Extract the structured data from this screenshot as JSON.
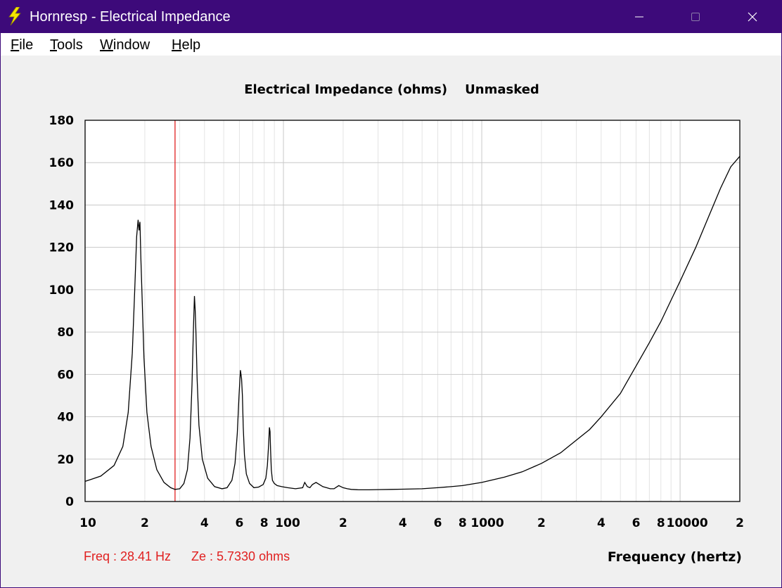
{
  "window": {
    "title": "Hornresp - Electrical Impedance",
    "accent": "#3d0a7a",
    "controls": [
      "minimize-icon",
      "maximize-icon",
      "close-icon"
    ]
  },
  "menu": [
    {
      "label": "File",
      "underline": "F"
    },
    {
      "label": "Tools",
      "underline": "T"
    },
    {
      "label": "Window",
      "underline": "W"
    },
    {
      "label": "Help",
      "underline": "H"
    }
  ],
  "status": {
    "freq": "Freq : 28.41 Hz",
    "ze": "Ze : 5.7330 ohms",
    "color": "#e02020"
  },
  "chart_data": {
    "type": "line",
    "title": "Electrical Impedance (ohms)    Unmasked",
    "xlabel": "Frequency (hertz)",
    "ylabel": "",
    "x_scale": "log",
    "xlim": [
      10,
      20000
    ],
    "ylim": [
      0,
      180
    ],
    "y_ticks": [
      "0",
      "20",
      "40",
      "60",
      "80",
      "100",
      "120",
      "140",
      "160",
      "180"
    ],
    "x_tick_labels": [
      {
        "value": 10,
        "label": "10"
      },
      {
        "value": 20,
        "label": "2"
      },
      {
        "value": 40,
        "label": "4"
      },
      {
        "value": 60,
        "label": "6"
      },
      {
        "value": 80,
        "label": "8"
      },
      {
        "value": 100,
        "label": "100"
      },
      {
        "value": 200,
        "label": "2"
      },
      {
        "value": 400,
        "label": "4"
      },
      {
        "value": 600,
        "label": "6"
      },
      {
        "value": 800,
        "label": "8"
      },
      {
        "value": 1000,
        "label": "1000"
      },
      {
        "value": 2000,
        "label": "2"
      },
      {
        "value": 4000,
        "label": "4"
      },
      {
        "value": 6000,
        "label": "6"
      },
      {
        "value": 8000,
        "label": "8"
      },
      {
        "value": 10000,
        "label": "10000"
      },
      {
        "value": 20000,
        "label": "2"
      }
    ],
    "grid": true,
    "cursor_freq": 28.41,
    "cursor_color": "#e02020",
    "line_color": "#000000",
    "series": [
      {
        "x": [
          10,
          12,
          14,
          15.5,
          16.5,
          17.3,
          17.8,
          18.2,
          18.5,
          18.7,
          18.9,
          19.1,
          19.4,
          19.8,
          20.5,
          21.5,
          23,
          25,
          27,
          28.4,
          30,
          31.5,
          32.8,
          33.8,
          34.6,
          35.2,
          35.6,
          35.9,
          36.2,
          36.7,
          37.5,
          39,
          41.5,
          45,
          49,
          52,
          55,
          57,
          58.5,
          59.7,
          60.7,
          61.5,
          62.1,
          62.7,
          63.6,
          65,
          67.5,
          71,
          75,
          79,
          81.5,
          83,
          84.2,
          85,
          85.6,
          86.2,
          86.9,
          88,
          90,
          93,
          98,
          105,
          115,
          125,
          128,
          132,
          136,
          140,
          146,
          152,
          158,
          165,
          172,
          180,
          190,
          200,
          210,
          220,
          240,
          270,
          300,
          350,
          400,
          500,
          600,
          700,
          800,
          1000,
          1300,
          1600,
          2000,
          2500,
          3000,
          3500,
          4000,
          5000,
          6000,
          7000,
          8000,
          9000,
          10000,
          12000,
          14000,
          16000,
          18000,
          20000
        ],
        "y": [
          9.5,
          12,
          17,
          26,
          42,
          70,
          100,
          125,
          133,
          128,
          132,
          115,
          95,
          68,
          42,
          26,
          15,
          9,
          6.5,
          5.7,
          6,
          8.5,
          15,
          30,
          55,
          82,
          97,
          90,
          80,
          58,
          36,
          20,
          11,
          7,
          6,
          6.5,
          10,
          18,
          32,
          50,
          62,
          58,
          50,
          35,
          22,
          13,
          8.5,
          6.5,
          6.8,
          8,
          11,
          17,
          27,
          35,
          33,
          24,
          15,
          10,
          8.5,
          7.5,
          7,
          6.5,
          6,
          6.5,
          9,
          7,
          6.5,
          8,
          9,
          8,
          7,
          6.5,
          6,
          6,
          7.5,
          6.5,
          6,
          5.7,
          5.5,
          5.5,
          5.6,
          5.7,
          5.8,
          6,
          6.5,
          7,
          7.5,
          9,
          11.5,
          14,
          18,
          23,
          29,
          34,
          40,
          51,
          64,
          75,
          85,
          95,
          104,
          120,
          135,
          148,
          158,
          163
        ]
      }
    ]
  }
}
